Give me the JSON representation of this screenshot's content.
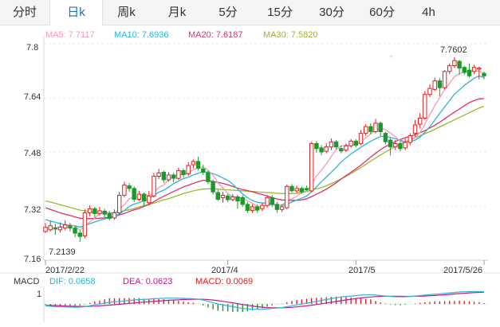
{
  "tabs": [
    {
      "label": "分时",
      "active": false
    },
    {
      "label": "日k",
      "active": true
    },
    {
      "label": "周k",
      "active": false
    },
    {
      "label": "月k",
      "active": false
    },
    {
      "label": "5分",
      "active": false
    },
    {
      "label": "15分",
      "active": false
    },
    {
      "label": "30分",
      "active": false
    },
    {
      "label": "60分",
      "active": false
    },
    {
      "label": "4h",
      "active": false
    }
  ],
  "ma_legend": {
    "ma5": "MA5: 7.7117",
    "ma10": "MA10: 7.6936",
    "ma20": "MA20: 7.6187",
    "ma30": "MA30: 7.5820"
  },
  "macd_legend": {
    "name": "MACD",
    "dif": "DIF: 0.0658",
    "dea": "DEA: 0.0623",
    "macd": "MACD: 0.0069"
  },
  "colors": {
    "up": "#e02020",
    "down": "#1a9a2a",
    "ma5": "#f59ab5",
    "ma10": "#2bb5d6",
    "ma20": "#e0306a",
    "ma30": "#99b82c",
    "dif": "#2bb5d6",
    "dea": "#c2188c",
    "macd_text": "#e02020",
    "active_tab": "#1a6fc9"
  },
  "chart_data": {
    "type": "candlestick",
    "y_ticks": [
      "7.8",
      "7.64",
      "7.48",
      "7.32",
      "7.16"
    ],
    "ylim": [
      7.16,
      7.8
    ],
    "x_tick_labels": [
      "2017/2/22",
      "2017/4",
      "2017/5",
      "2017/5/26"
    ],
    "high_label": "7.7602",
    "low_label": "7.2139",
    "macd_ytick": "1",
    "candles": [
      [
        7.245,
        7.257,
        7.27,
        7.24
      ],
      [
        7.25,
        7.262,
        7.275,
        7.245
      ],
      [
        7.255,
        7.252,
        7.268,
        7.235
      ],
      [
        7.25,
        7.258,
        7.272,
        7.242
      ],
      [
        7.255,
        7.264,
        7.278,
        7.248
      ],
      [
        7.262,
        7.255,
        7.27,
        7.245
      ],
      [
        7.255,
        7.24,
        7.262,
        7.228
      ],
      [
        7.24,
        7.23,
        7.248,
        7.214
      ],
      [
        7.232,
        7.3,
        7.31,
        7.225
      ],
      [
        7.3,
        7.312,
        7.322,
        7.29
      ],
      [
        7.312,
        7.298,
        7.318,
        7.285
      ],
      [
        7.298,
        7.306,
        7.318,
        7.292
      ],
      [
        7.305,
        7.296,
        7.312,
        7.285
      ],
      [
        7.298,
        7.284,
        7.305,
        7.278
      ],
      [
        7.285,
        7.3,
        7.31,
        7.28
      ],
      [
        7.3,
        7.352,
        7.362,
        7.295
      ],
      [
        7.352,
        7.382,
        7.392,
        7.346
      ],
      [
        7.38,
        7.372,
        7.388,
        7.362
      ],
      [
        7.372,
        7.34,
        7.378,
        7.332
      ],
      [
        7.34,
        7.355,
        7.365,
        7.334
      ],
      [
        7.355,
        7.335,
        7.36,
        7.32
      ],
      [
        7.33,
        7.35,
        7.365,
        7.322
      ],
      [
        7.35,
        7.408,
        7.418,
        7.345
      ],
      [
        7.408,
        7.418,
        7.43,
        7.4
      ],
      [
        7.42,
        7.398,
        7.425,
        7.388
      ],
      [
        7.398,
        7.412,
        7.42,
        7.392
      ],
      [
        7.412,
        7.402,
        7.418,
        7.39
      ],
      [
        7.402,
        7.425,
        7.434,
        7.398
      ],
      [
        7.425,
        7.413,
        7.43,
        7.404
      ],
      [
        7.415,
        7.44,
        7.45,
        7.41
      ],
      [
        7.442,
        7.452,
        7.458,
        7.432
      ],
      [
        7.452,
        7.432,
        7.466,
        7.425
      ],
      [
        7.43,
        7.42,
        7.442,
        7.412
      ],
      [
        7.418,
        7.392,
        7.425,
        7.385
      ],
      [
        7.392,
        7.362,
        7.398,
        7.355
      ],
      [
        7.36,
        7.34,
        7.368,
        7.335
      ],
      [
        7.345,
        7.352,
        7.362,
        7.33
      ],
      [
        7.35,
        7.339,
        7.356,
        7.332
      ],
      [
        7.339,
        7.347,
        7.356,
        7.334
      ],
      [
        7.347,
        7.335,
        7.353,
        7.312
      ],
      [
        7.345,
        7.325,
        7.352,
        7.318
      ],
      [
        7.325,
        7.307,
        7.332,
        7.3
      ],
      [
        7.307,
        7.318,
        7.326,
        7.3
      ],
      [
        7.318,
        7.308,
        7.325,
        7.3
      ],
      [
        7.312,
        7.322,
        7.33,
        7.305
      ],
      [
        7.322,
        7.345,
        7.352,
        7.315
      ],
      [
        7.345,
        7.325,
        7.352,
        7.317
      ],
      [
        7.325,
        7.31,
        7.332,
        7.3
      ],
      [
        7.31,
        7.318,
        7.325,
        7.302
      ],
      [
        7.315,
        7.378,
        7.384,
        7.31
      ],
      [
        7.378,
        7.365,
        7.385,
        7.36
      ],
      [
        7.365,
        7.372,
        7.38,
        7.358
      ],
      [
        7.372,
        7.362,
        7.378,
        7.356
      ],
      [
        7.372,
        7.368,
        7.38,
        7.365
      ],
      [
        7.365,
        7.505,
        7.51,
        7.36
      ],
      [
        7.505,
        7.49,
        7.512,
        7.478
      ],
      [
        7.492,
        7.48,
        7.5,
        7.47
      ],
      [
        7.482,
        7.495,
        7.505,
        7.476
      ],
      [
        7.495,
        7.51,
        7.52,
        7.485
      ],
      [
        7.51,
        7.495,
        7.515,
        7.488
      ],
      [
        7.49,
        7.483,
        7.498,
        7.476
      ],
      [
        7.485,
        7.498,
        7.505,
        7.48
      ],
      [
        7.498,
        7.512,
        7.518,
        7.492
      ],
      [
        7.512,
        7.5,
        7.518,
        7.494
      ],
      [
        7.505,
        7.535,
        7.545,
        7.5
      ],
      [
        7.535,
        7.555,
        7.562,
        7.528
      ],
      [
        7.555,
        7.54,
        7.565,
        7.532
      ],
      [
        7.54,
        7.565,
        7.578,
        7.535
      ],
      [
        7.565,
        7.54,
        7.57,
        7.528
      ],
      [
        7.535,
        7.51,
        7.54,
        7.502
      ],
      [
        7.515,
        7.495,
        7.52,
        7.47
      ],
      [
        7.495,
        7.505,
        7.515,
        7.485
      ],
      [
        7.505,
        7.49,
        7.512,
        7.482
      ],
      [
        7.492,
        7.508,
        7.52,
        7.485
      ],
      [
        7.508,
        7.528,
        7.535,
        7.5
      ],
      [
        7.535,
        7.56,
        7.575,
        7.525
      ],
      [
        7.562,
        7.58,
        7.595,
        7.55
      ],
      [
        7.58,
        7.65,
        7.66,
        7.575
      ],
      [
        7.65,
        7.668,
        7.68,
        7.642
      ],
      [
        7.665,
        7.69,
        7.7,
        7.66
      ],
      [
        7.69,
        7.67,
        7.698,
        7.645
      ],
      [
        7.67,
        7.718,
        7.722,
        7.665
      ],
      [
        7.718,
        7.735,
        7.742,
        7.71
      ],
      [
        7.735,
        7.75,
        7.76,
        7.728
      ],
      [
        7.748,
        7.728,
        7.752,
        7.708
      ],
      [
        7.73,
        7.715,
        7.735,
        7.708
      ],
      [
        7.722,
        7.705,
        7.742,
        7.7
      ],
      [
        7.718,
        7.73,
        7.738,
        7.71
      ],
      [
        7.725,
        7.728,
        7.732,
        7.695
      ],
      [
        7.712,
        7.705,
        7.718,
        7.695
      ]
    ],
    "ma5": [
      7.255,
      7.256,
      7.256,
      7.258,
      7.263,
      7.265,
      7.26,
      7.249,
      7.26,
      7.273,
      7.284,
      7.299,
      7.304,
      7.299,
      7.299,
      7.31,
      7.324,
      7.342,
      7.346,
      7.35,
      7.357,
      7.35,
      7.36,
      7.375,
      7.382,
      7.398,
      7.408,
      7.41,
      7.414,
      7.418,
      7.428,
      7.432,
      7.436,
      7.426,
      7.411,
      7.389,
      7.373,
      7.357,
      7.348,
      7.347,
      7.342,
      7.336,
      7.328,
      7.319,
      7.316,
      7.324,
      7.324,
      7.322,
      7.323,
      7.336,
      7.342,
      7.349,
      7.36,
      7.365,
      7.383,
      7.409,
      7.426,
      7.445,
      7.467,
      7.487,
      7.498,
      7.5,
      7.501,
      7.503,
      7.508,
      7.522,
      7.534,
      7.543,
      7.551,
      7.546,
      7.536,
      7.525,
      7.512,
      7.508,
      7.511,
      7.522,
      7.538,
      7.562,
      7.59,
      7.617,
      7.641,
      7.664,
      7.683,
      7.703,
      7.711,
      7.718,
      7.718,
      7.719,
      7.719,
      7.712
    ],
    "ma10": [
      7.28,
      7.276,
      7.272,
      7.268,
      7.265,
      7.264,
      7.262,
      7.258,
      7.262,
      7.268,
      7.273,
      7.278,
      7.282,
      7.285,
      7.289,
      7.297,
      7.307,
      7.319,
      7.326,
      7.33,
      7.336,
      7.342,
      7.351,
      7.361,
      7.367,
      7.376,
      7.386,
      7.394,
      7.401,
      7.406,
      7.412,
      7.417,
      7.422,
      7.42,
      7.416,
      7.41,
      7.403,
      7.396,
      7.385,
      7.37,
      7.356,
      7.345,
      7.336,
      7.331,
      7.329,
      7.329,
      7.326,
      7.323,
      7.322,
      7.325,
      7.332,
      7.338,
      7.343,
      7.35,
      7.362,
      7.377,
      7.392,
      7.406,
      7.42,
      7.434,
      7.45,
      7.463,
      7.474,
      7.484,
      7.494,
      7.503,
      7.512,
      7.519,
      7.526,
      7.526,
      7.523,
      7.519,
      7.515,
      7.51,
      7.51,
      7.515,
      7.524,
      7.538,
      7.555,
      7.574,
      7.594,
      7.613,
      7.632,
      7.651,
      7.664,
      7.677,
      7.688,
      7.698,
      7.705,
      7.7
    ],
    "ma20": [
      7.315,
      7.31,
      7.305,
      7.3,
      7.296,
      7.292,
      7.288,
      7.284,
      7.283,
      7.283,
      7.283,
      7.284,
      7.285,
      7.287,
      7.289,
      7.294,
      7.298,
      7.304,
      7.309,
      7.313,
      7.319,
      7.325,
      7.333,
      7.342,
      7.349,
      7.356,
      7.363,
      7.37,
      7.377,
      7.382,
      7.387,
      7.392,
      7.396,
      7.395,
      7.393,
      7.39,
      7.387,
      7.383,
      7.378,
      7.373,
      7.369,
      7.366,
      7.362,
      7.358,
      7.354,
      7.35,
      7.345,
      7.341,
      7.338,
      7.337,
      7.337,
      7.337,
      7.338,
      7.342,
      7.348,
      7.355,
      7.362,
      7.37,
      7.379,
      7.389,
      7.4,
      7.41,
      7.42,
      7.43,
      7.441,
      7.453,
      7.465,
      7.476,
      7.487,
      7.496,
      7.503,
      7.511,
      7.517,
      7.522,
      7.526,
      7.531,
      7.537,
      7.543,
      7.551,
      7.559,
      7.568,
      7.578,
      7.588,
      7.598,
      7.607,
      7.617,
      7.626,
      7.632,
      7.637,
      7.638
    ],
    "ma30": [
      7.335,
      7.332,
      7.328,
      7.324,
      7.32,
      7.316,
      7.312,
      7.308,
      7.306,
      7.304,
      7.302,
      7.301,
      7.3,
      7.3,
      7.301,
      7.303,
      7.306,
      7.309,
      7.313,
      7.317,
      7.321,
      7.325,
      7.329,
      7.334,
      7.338,
      7.342,
      7.347,
      7.352,
      7.357,
      7.361,
      7.365,
      7.368,
      7.37,
      7.371,
      7.371,
      7.37,
      7.369,
      7.368,
      7.367,
      7.366,
      7.365,
      7.364,
      7.363,
      7.362,
      7.361,
      7.36,
      7.359,
      7.358,
      7.357,
      7.357,
      7.357,
      7.358,
      7.36,
      7.363,
      7.367,
      7.371,
      7.375,
      7.38,
      7.386,
      7.393,
      7.4,
      7.408,
      7.416,
      7.425,
      7.434,
      7.443,
      7.453,
      7.462,
      7.471,
      7.48,
      7.488,
      7.496,
      7.503,
      7.51,
      7.516,
      7.522,
      7.528,
      7.534,
      7.54,
      7.547,
      7.554,
      7.561,
      7.568,
      7.575,
      7.582,
      7.589,
      7.596,
      7.603,
      7.61,
      7.615
    ],
    "macd_ylim": [
      -1.6,
      1.8
    ],
    "dif": [
      -0.2,
      -0.25,
      -0.3,
      -0.32,
      -0.34,
      -0.35,
      -0.36,
      -0.35,
      -0.3,
      -0.2,
      -0.1,
      0.0,
      0.1,
      0.2,
      0.25,
      0.3,
      0.35,
      0.4,
      0.45,
      0.5,
      0.52,
      0.55,
      0.6,
      0.62,
      0.65,
      0.66,
      0.66,
      0.65,
      0.64,
      0.62,
      0.6,
      0.55,
      0.45,
      0.3,
      0.15,
      0.0,
      -0.1,
      -0.2,
      -0.3,
      -0.4,
      -0.5,
      -0.55,
      -0.58,
      -0.6,
      -0.6,
      -0.55,
      -0.5,
      -0.45,
      -0.4,
      -0.3,
      -0.2,
      -0.1,
      0.0,
      0.1,
      0.2,
      0.3,
      0.4,
      0.5,
      0.6,
      0.7,
      0.8,
      0.85,
      0.9,
      0.95,
      1.0,
      1.02,
      1.05,
      1.0,
      0.95,
      0.9,
      0.85,
      0.82,
      0.8,
      0.82,
      0.85,
      0.9,
      0.95,
      1.0,
      1.05,
      1.1,
      1.15,
      1.2,
      1.25,
      1.3,
      1.35,
      1.38,
      1.4,
      1.4,
      1.4,
      1.38
    ],
    "dea": [
      -0.15,
      -0.16,
      -0.18,
      -0.2,
      -0.22,
      -0.24,
      -0.26,
      -0.27,
      -0.27,
      -0.26,
      -0.24,
      -0.2,
      -0.16,
      -0.12,
      -0.08,
      -0.03,
      0.02,
      0.07,
      0.12,
      0.17,
      0.22,
      0.26,
      0.3,
      0.34,
      0.38,
      0.42,
      0.45,
      0.48,
      0.5,
      0.52,
      0.53,
      0.54,
      0.53,
      0.5,
      0.45,
      0.38,
      0.3,
      0.22,
      0.14,
      0.05,
      -0.05,
      -0.14,
      -0.22,
      -0.3,
      -0.36,
      -0.4,
      -0.42,
      -0.43,
      -0.42,
      -0.4,
      -0.37,
      -0.32,
      -0.26,
      -0.2,
      -0.13,
      -0.05,
      0.03,
      0.12,
      0.2,
      0.29,
      0.38,
      0.46,
      0.54,
      0.61,
      0.68,
      0.74,
      0.79,
      0.83,
      0.86,
      0.87,
      0.88,
      0.88,
      0.87,
      0.86,
      0.86,
      0.87,
      0.88,
      0.9,
      0.93,
      0.96,
      1.0,
      1.04,
      1.08,
      1.13,
      1.17,
      1.21,
      1.25,
      1.28,
      1.31,
      1.33
    ]
  }
}
